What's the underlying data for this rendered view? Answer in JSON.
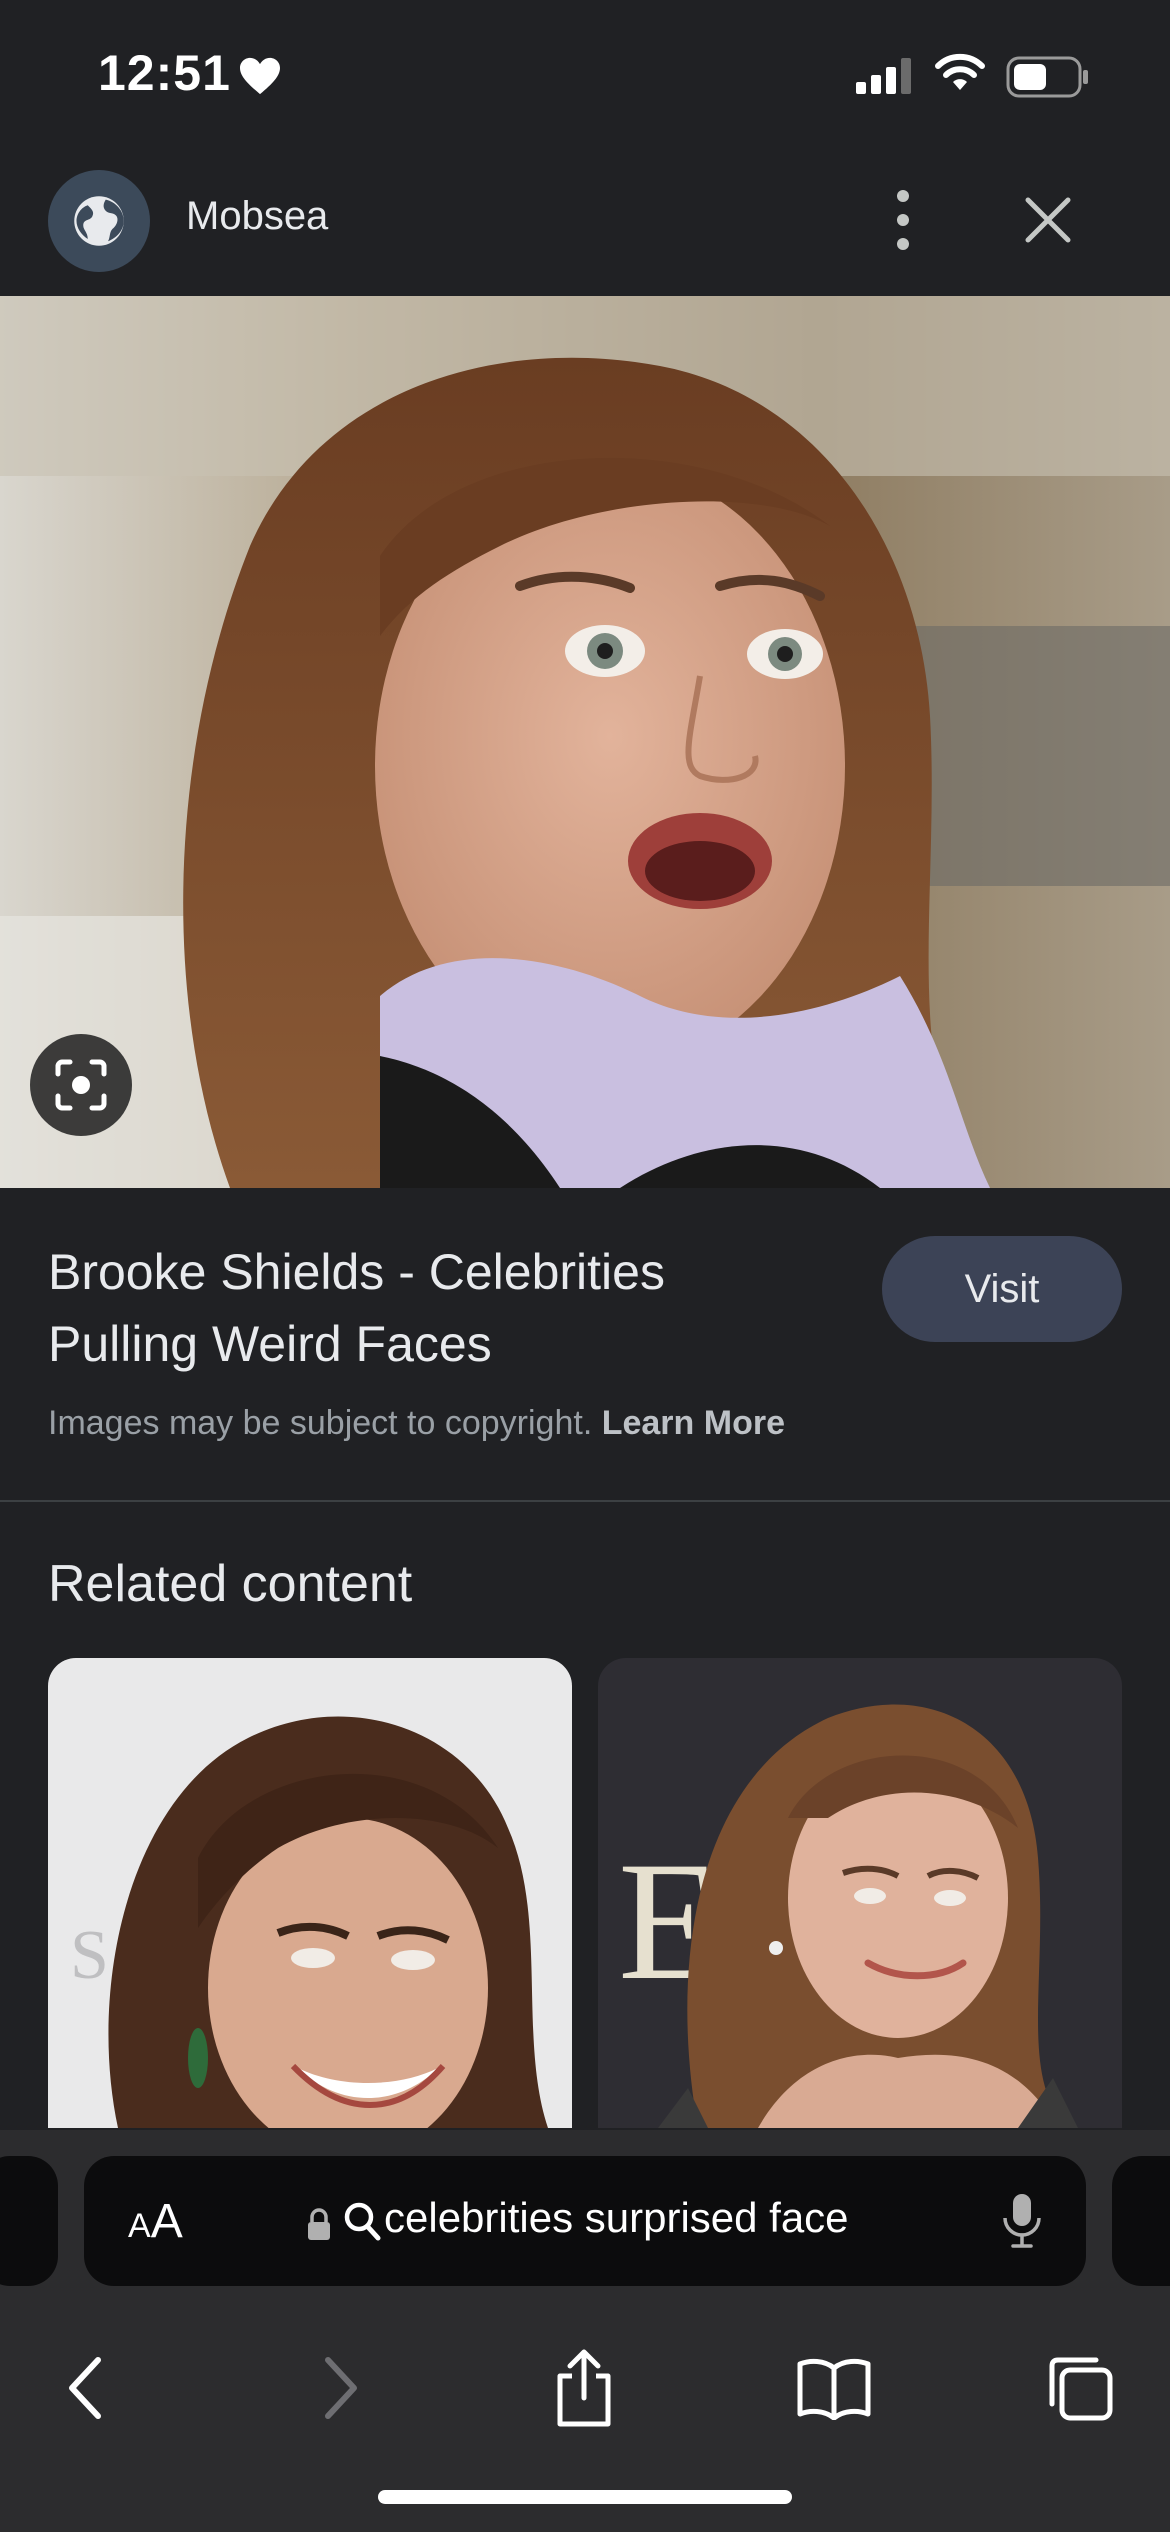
{
  "status_bar": {
    "time": "12:51"
  },
  "header": {
    "site_name": "Mobsea"
  },
  "result": {
    "title": "Brooke Shields - Celebrities Pulling Weird Faces",
    "visit_label": "Visit",
    "copyright_text": "Images may be subject to copyright.",
    "learn_more_label": "Learn More"
  },
  "related": {
    "heading": "Related content"
  },
  "browser": {
    "text_size_label_small": "A",
    "text_size_label_large": "A",
    "url_text": "celebrities surprised face"
  },
  "icons": {
    "heart": "heart-icon",
    "signal": "cellular-signal-icon",
    "wifi": "wifi-icon",
    "battery": "battery-icon",
    "globe": "globe-icon",
    "more": "more-vertical-icon",
    "close": "close-icon",
    "lens": "lens-scan-icon",
    "lock": "lock-icon",
    "search": "search-icon",
    "mic": "microphone-icon",
    "back": "back-icon",
    "forward": "forward-icon",
    "share": "share-icon",
    "bookmarks": "bookmarks-icon",
    "tabs": "tabs-icon"
  },
  "colors": {
    "background": "#202124",
    "visit_button": "#3c4356",
    "toolbar": "#2c2c2e",
    "address_bar": "#0c0c0d"
  }
}
